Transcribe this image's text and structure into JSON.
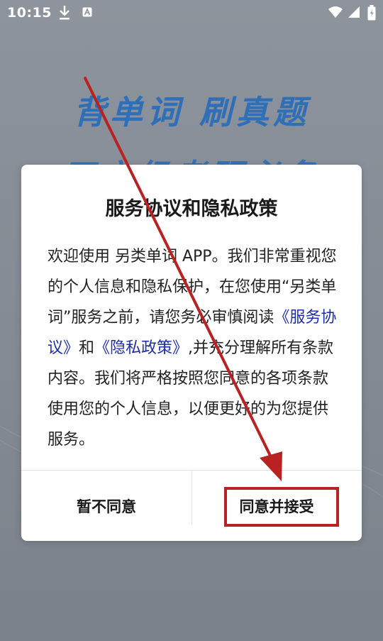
{
  "status_bar": {
    "time": "10:15",
    "icons": [
      "download-icon",
      "a-badge-icon",
      "wifi-icon",
      "signal-icon",
      "battery-icon"
    ]
  },
  "background": {
    "headline_1": "背单词 刷真题",
    "headline_2": "四六级考研必备"
  },
  "dialog": {
    "title": "服务协议和隐私政策",
    "body": {
      "part1": "欢迎使用 另类单词 APP。我们非常重视您的个人信息和隐私保护，在您使用“另类单词”服务之前，请您务必审慎阅读",
      "link_terms": "《服务协议》",
      "and": "和",
      "link_privacy": "《隐私政策》",
      "part2": ",并充分理解所有条款内容。我们将严格按照您同意的各项条款使用您的个人信息，以便更好的为您提供服务。"
    },
    "decline_label": "暂不同意",
    "accept_label": "同意并接受"
  },
  "annotation": {
    "color": "#b82222",
    "type": "arrow-and-box",
    "target": "accept_button"
  },
  "colors": {
    "link": "#1e2ea8",
    "banner": "#2e6fb8",
    "annotation": "#b82222"
  }
}
